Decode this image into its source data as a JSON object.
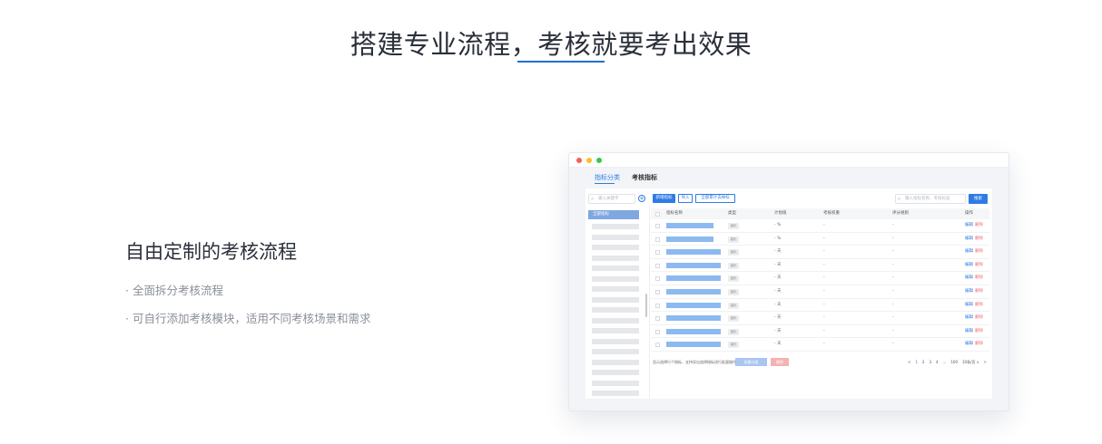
{
  "hero": {
    "title": "搭建专业流程，考核就要考出效果"
  },
  "feature": {
    "title": "自由定制的考核流程",
    "points": [
      "· 全面拆分考核流程",
      "· 可自行添加考核模块，适用不同考核场景和需求"
    ]
  },
  "colors": {
    "accent": "#1f6fd1",
    "primary_button": "#2f7be5",
    "delete": "#f26b6b"
  },
  "mockup": {
    "tabs": [
      "指标分类",
      "考核指标"
    ],
    "sidebar": {
      "search_placeholder": "输入关键字",
      "add_icon": "plus-circle-icon",
      "active_item": "全部指标"
    },
    "toolbar": {
      "new_label": "新增指标",
      "import_label": "导入",
      "calc_label": "全部累计去掉标",
      "search_placeholder": "输入指标名称、考核标准",
      "search_label": "搜索"
    },
    "table": {
      "headers": [
        "指标名称",
        "类型",
        "计划值",
        "考核权重",
        "评分规则",
        "操作"
      ],
      "rows": [
        {
          "type": "量化",
          "plan": "- %",
          "weight": "-",
          "rule": "-",
          "edit": "编辑",
          "del": "删除"
        },
        {
          "type": "量化",
          "plan": "- %",
          "weight": "-",
          "rule": "-",
          "edit": "编辑",
          "del": "删除"
        },
        {
          "type": "量化",
          "plan": "- 天",
          "weight": "-",
          "rule": "-",
          "edit": "编辑",
          "del": "删除"
        },
        {
          "type": "量化",
          "plan": "- 天",
          "weight": "-",
          "rule": "-",
          "edit": "编辑",
          "del": "删除"
        },
        {
          "type": "量化",
          "plan": "- 天",
          "weight": "-",
          "rule": "-",
          "edit": "编辑",
          "del": "删除"
        },
        {
          "type": "量化",
          "plan": "- 天",
          "weight": "-",
          "rule": "-",
          "edit": "编辑",
          "del": "删除"
        },
        {
          "type": "量化",
          "plan": "- 天",
          "weight": "-",
          "rule": "-",
          "edit": "编辑",
          "del": "删除"
        },
        {
          "type": "量化",
          "plan": "- 天",
          "weight": "-",
          "rule": "-",
          "edit": "编辑",
          "del": "删除"
        },
        {
          "type": "量化",
          "plan": "- 天",
          "weight": "-",
          "rule": "-",
          "edit": "编辑",
          "del": "删除"
        },
        {
          "type": "量化",
          "plan": "- 天",
          "weight": "-",
          "rule": "-",
          "edit": "编辑",
          "del": "删除"
        }
      ]
    },
    "footer": {
      "note": "显示选择行个指标，支持导出选择指标进行批量操作",
      "batch_label": "批量分类",
      "delete_label": "删除",
      "pages": [
        "<",
        "1",
        "2",
        "3",
        "4",
        "...",
        "100",
        "10条/页 ∨",
        ">"
      ]
    }
  }
}
